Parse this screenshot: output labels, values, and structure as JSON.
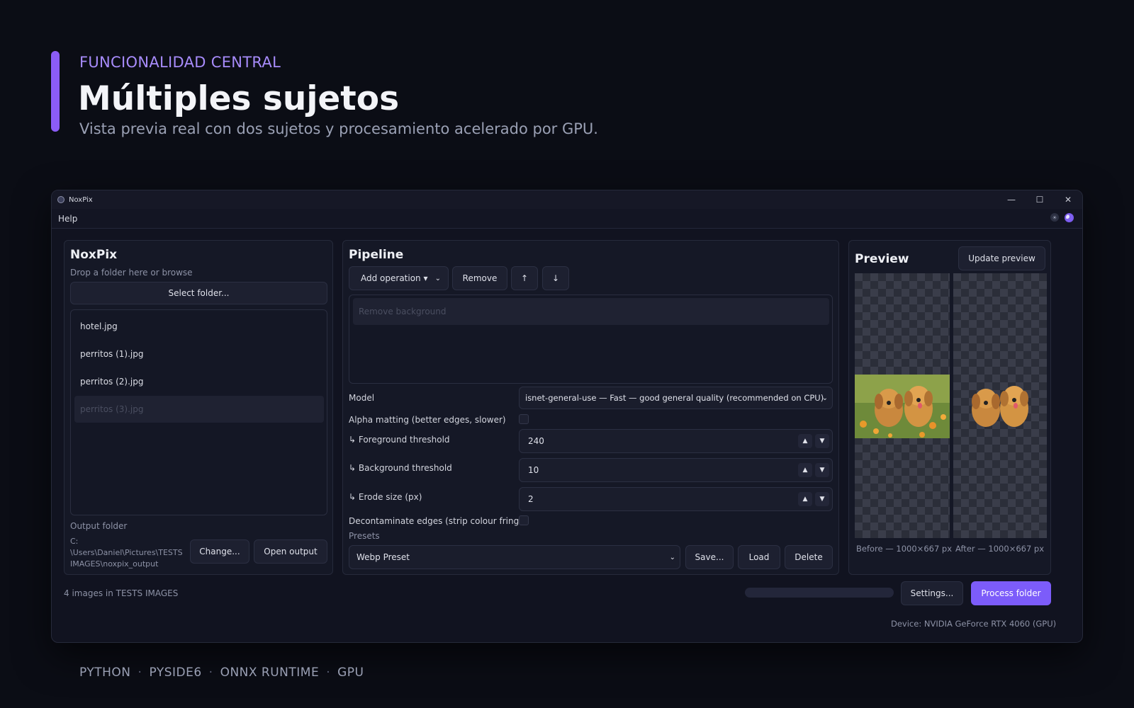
{
  "slide": {
    "eyebrow": "FUNCIONALIDAD CENTRAL",
    "title": "Múltiples sujetos",
    "subtitle": "Vista previa real con dos sujetos y procesamiento acelerado por GPU.",
    "tech": [
      "PYTHON",
      "PYSIDE6",
      "ONNX RUNTIME",
      "GPU"
    ],
    "accent_color": "#8b5cf6"
  },
  "window": {
    "title": "NoxPix",
    "controls": {
      "minimize": "—",
      "maximize": "☐",
      "close": "✕"
    }
  },
  "menu": {
    "help": "Help"
  },
  "files_panel": {
    "title": "NoxPix",
    "hint": "Drop a folder here or browse",
    "select_button": "Select folder...",
    "files": [
      "hotel.jpg",
      "perritos (1).jpg",
      "perritos (2).jpg",
      "perritos (3).jpg"
    ],
    "selected_index": 3,
    "output_label": "Output folder",
    "output_path_1": "C:",
    "output_path_2": "\\Users\\Daniel\\Pictures\\TESTS",
    "output_path_3": "IMAGES\\noxpix_output",
    "change_button": "Change...",
    "open_output_button": "Open output"
  },
  "pipeline": {
    "title": "Pipeline",
    "add_operation": "Add operation ▾",
    "remove_button": "Remove",
    "up_button": "↑",
    "down_button": "↓",
    "operations": [
      "Remove background"
    ],
    "model_label": "Model",
    "model_value": "isnet-general-use — Fast — good general quality (recommended on CPU)",
    "alpha_label": "Alpha matting (better edges, slower)",
    "fg_label": "↳ Foreground threshold",
    "fg_value": "240",
    "bg_label": "↳ Background threshold",
    "bg_value": "10",
    "erode_label": "↳ Erode size (px)",
    "erode_value": "2",
    "decontaminate_label": "Decontaminate edges (strip colour fringe)",
    "presets_label": "Presets",
    "preset_value": "Webp Preset",
    "save_button": "Save...",
    "load_button": "Load",
    "delete_button": "Delete"
  },
  "preview": {
    "title": "Preview",
    "update_button": "Update preview",
    "before_caption": "Before — 1000×667 px",
    "after_caption": "After — 1000×667 px"
  },
  "status": {
    "count_text": "4 images in TESTS IMAGES",
    "settings_button": "Settings...",
    "process_button": "Process folder",
    "device_text": "Device: NVIDIA GeForce RTX 4060 (GPU)",
    "progress": 0
  }
}
